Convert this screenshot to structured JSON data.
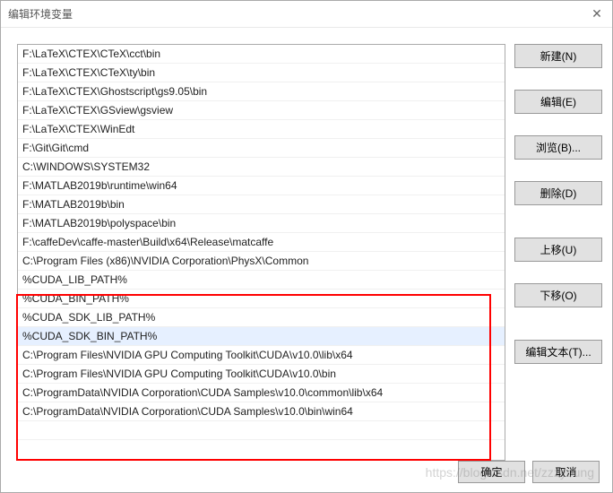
{
  "dialog": {
    "title": "编辑环境变量"
  },
  "list": {
    "items": [
      "F:\\LaTeX\\CTEX\\CTeX\\cct\\bin",
      "F:\\LaTeX\\CTEX\\CTeX\\ty\\bin",
      "F:\\LaTeX\\CTEX\\Ghostscript\\gs9.05\\bin",
      "F:\\LaTeX\\CTEX\\GSview\\gsview",
      "F:\\LaTeX\\CTEX\\WinEdt",
      "F:\\Git\\Git\\cmd",
      "C:\\WINDOWS\\SYSTEM32",
      "F:\\MATLAB2019b\\runtime\\win64",
      "F:\\MATLAB2019b\\bin",
      "F:\\MATLAB2019b\\polyspace\\bin",
      "F:\\caffeDev\\caffe-master\\Build\\x64\\Release\\matcaffe",
      "C:\\Program Files (x86)\\NVIDIA Corporation\\PhysX\\Common",
      "%CUDA_LIB_PATH%",
      "%CUDA_BIN_PATH%",
      "%CUDA_SDK_LIB_PATH%",
      "%CUDA_SDK_BIN_PATH%",
      "C:\\Program Files\\NVIDIA GPU Computing Toolkit\\CUDA\\v10.0\\lib\\x64",
      "C:\\Program Files\\NVIDIA GPU Computing Toolkit\\CUDA\\v10.0\\bin",
      "C:\\ProgramData\\NVIDIA Corporation\\CUDA Samples\\v10.0\\common\\lib\\x64",
      "C:\\ProgramData\\NVIDIA Corporation\\CUDA Samples\\v10.0\\bin\\win64"
    ],
    "selected_index": 15
  },
  "buttons": {
    "new": "新建(N)",
    "edit": "编辑(E)",
    "browse": "浏览(B)...",
    "delete": "删除(D)",
    "moveup": "上移(U)",
    "movedown": "下移(O)",
    "edittext": "编辑文本(T)..."
  },
  "footer": {
    "ok": "确定",
    "cancel": "取消"
  },
  "watermark": "https://blog.csdn.net/zzzyoung"
}
